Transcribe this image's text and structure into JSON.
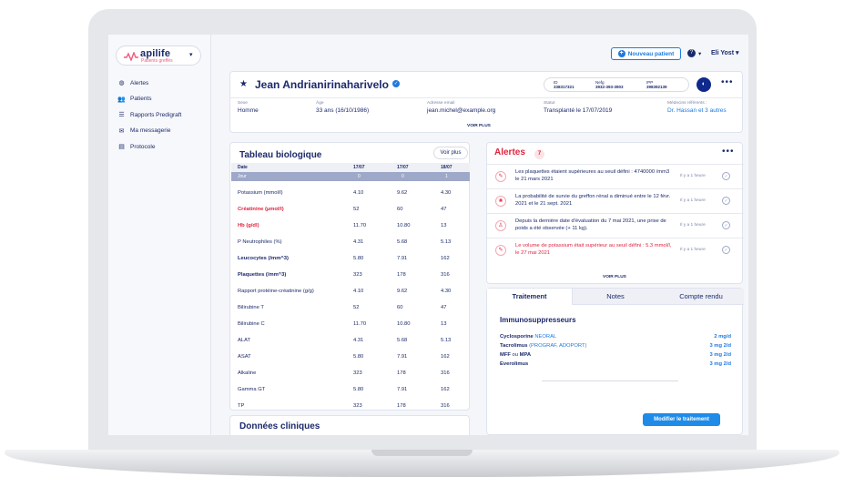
{
  "brand": {
    "name": "apilife",
    "subtitle": "Patients greffés",
    "accent": "#f05a7e",
    "primary": "#1b2a6b",
    "link": "#1e7ae0"
  },
  "sidebar": {
    "items": [
      {
        "label": "Alertes",
        "icon": "globe-icon"
      },
      {
        "label": "Patients",
        "icon": "users-icon"
      },
      {
        "label": "Rapports Predigraft",
        "icon": "sliders-icon"
      },
      {
        "label": "Ma messagerie",
        "icon": "chat-icon"
      },
      {
        "label": "Protocole",
        "icon": "clipboard-icon"
      }
    ]
  },
  "topbar": {
    "new_patient": "Nouveau patient",
    "help": "?",
    "user": "Eli Yost"
  },
  "patient": {
    "name": "Jean Andrianirinaharivelo",
    "ids": [
      {
        "label": "ID",
        "value": "338317321"
      },
      {
        "label": "Nefg",
        "value": "3932-393-3903"
      },
      {
        "label": "IPP",
        "value": "398392139"
      }
    ],
    "fields": [
      {
        "label": "Sexe",
        "value": "Homme"
      },
      {
        "label": "Âge",
        "value": "33 ans (16/10/1986)"
      },
      {
        "label": "Adresse email",
        "value": "jean.michel@example.org"
      },
      {
        "label": "Statut",
        "value": "Transplanté le 17/07/2019"
      },
      {
        "label": "Médecins référents :",
        "value": "Dr. Hassan et 3 autres"
      }
    ],
    "voir_plus": "VOIR PLUS"
  },
  "bio": {
    "title": "Tableau biologique",
    "voir_plus": "Voir plus",
    "header": {
      "label": "Date",
      "cols": [
        "17/07",
        "17/07",
        "18/07"
      ]
    },
    "jour": {
      "label": "Jour",
      "cols": [
        "0",
        "0",
        "1"
      ]
    },
    "rows": [
      {
        "label": "Potassium (mmol/l)",
        "values": [
          "4.10",
          "9.62",
          "4.30"
        ],
        "style": ""
      },
      {
        "label": "Créatinine (µmol/l)",
        "values": [
          "52",
          "60",
          "47"
        ],
        "style": "red"
      },
      {
        "label": "Hb (g/dl)",
        "values": [
          "11.70",
          "10.80",
          "13"
        ],
        "style": "red"
      },
      {
        "label": "P Neutrophiles (%)",
        "values": [
          "4.31",
          "5.68",
          "5.13"
        ],
        "style": ""
      },
      {
        "label": "Leucocytes (/mm^3)",
        "values": [
          "5.80",
          "7.91",
          "162"
        ],
        "style": "bold"
      },
      {
        "label": "Plaquettes (/mm^3)",
        "values": [
          "323",
          "178",
          "316"
        ],
        "style": "bold"
      },
      {
        "label": "Rapport protéine-créatinine (g/g)",
        "values": [
          "4.10",
          "9.62",
          "4.30"
        ],
        "style": ""
      },
      {
        "label": "Bilirubine T",
        "values": [
          "52",
          "60",
          "47"
        ],
        "style": ""
      },
      {
        "label": "Bilirubine C",
        "values": [
          "11.70",
          "10.80",
          "13"
        ],
        "style": ""
      },
      {
        "label": "ALAT",
        "values": [
          "4.31",
          "5.68",
          "5.13"
        ],
        "style": ""
      },
      {
        "label": "ASAT",
        "values": [
          "5.80",
          "7.91",
          "162"
        ],
        "style": ""
      },
      {
        "label": "Alkaline",
        "values": [
          "323",
          "178",
          "316"
        ],
        "style": ""
      },
      {
        "label": "Gamma GT",
        "values": [
          "5.80",
          "7.91",
          "162"
        ],
        "style": ""
      },
      {
        "label": "TP",
        "values": [
          "323",
          "178",
          "316"
        ],
        "style": ""
      }
    ]
  },
  "donnees": {
    "title": "Données cliniques"
  },
  "alerts": {
    "title": "Alertes",
    "count": "7",
    "voir_plus": "VOIR PLUS",
    "items": [
      {
        "text": "Les plaquettes étaient supérieures au seuil défini : 4740000 /mm3 le 21 mars 2021",
        "time": "Il y a 1 heure",
        "red": false,
        "icon": "syringe-icon"
      },
      {
        "text": "La probabilité de survie du greffon rénal a diminué entre le 12 févr. 2021 et le 21 sept. 2021",
        "time": "Il y a 1 heure",
        "red": false,
        "icon": "kidney-icon"
      },
      {
        "text": "Depuis la dernière date d'évaluation du 7 mai 2021, une prise de poids a été observée (+ 11 kg).",
        "time": "Il y a 1 heure",
        "red": false,
        "icon": "person-icon"
      },
      {
        "text": "Le volume de potassium était supérieur au seuil défini : 5.3 mmol/l, le 27 mai 2021",
        "time": "Il y a 1 heure",
        "red": true,
        "icon": "syringe-icon"
      }
    ]
  },
  "treatment": {
    "tabs": [
      "Traitement",
      "Notes",
      "Compte rendu"
    ],
    "section": "Immunosuppresseurs",
    "rows": [
      {
        "name": "Cyclosporine",
        "alt": "NEORAL",
        "dose": "2 mg/d"
      },
      {
        "name": "Tacrolimus",
        "alt": "(PROGRAF, ADOPORT)",
        "dose": "3 mg 2/d"
      },
      {
        "name": "MFF",
        "alt": "ou",
        "name2": "MPA",
        "dose": "3 mg 2/d"
      },
      {
        "name": "Everolimus",
        "alt": "",
        "dose": "3 mg 2/d"
      }
    ],
    "button": "Modifier le traitement"
  }
}
